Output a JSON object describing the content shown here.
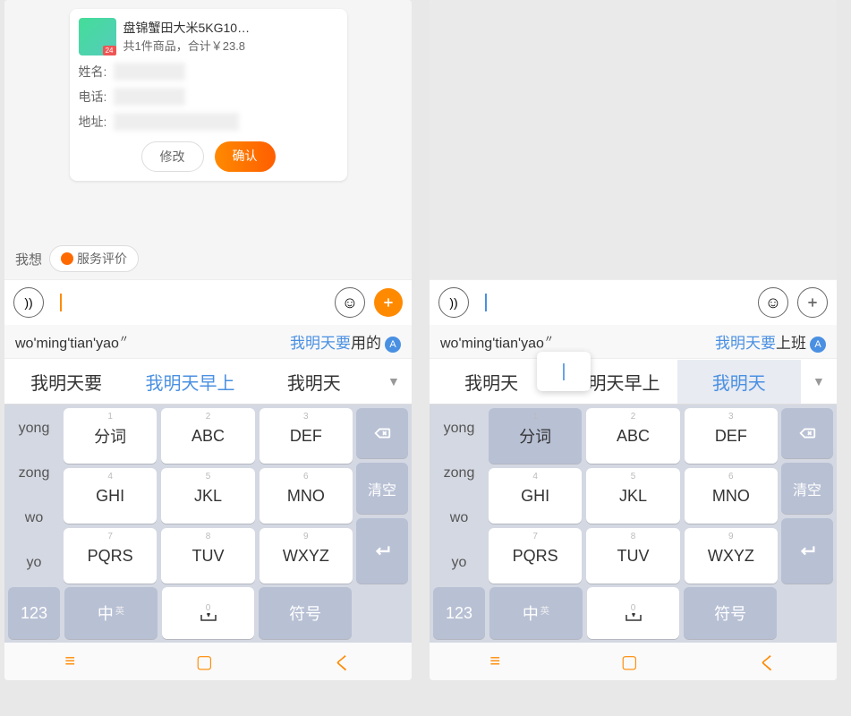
{
  "left": {
    "card": {
      "title": "盘锦蟹田大米5KG10…",
      "subtitle": "共1件商品，合计￥23.8",
      "fields": {
        "name": "姓名:",
        "phone": "电话:",
        "addr": "地址:"
      },
      "editBtn": "修改",
      "confirmBtn": "确认"
    },
    "quick": {
      "label": "我想",
      "chip": "服务评价"
    },
    "ime": {
      "pinyin": "wo'ming'tian'yao",
      "suggest_hl": "我明天要",
      "suggest_rest": "用的",
      "cands": [
        "我明天要",
        "我明天早上",
        "我明天"
      ]
    }
  },
  "right": {
    "ime": {
      "pinyin": "wo'ming'tian'yao",
      "suggest_hl": "我明天要",
      "suggest_rest": "上班",
      "cands": [
        "我明天",
        "我明天早上",
        "我明天"
      ]
    }
  },
  "kbd": {
    "sideCands": [
      "yong",
      "zong",
      "wo",
      "yo"
    ],
    "keys": [
      {
        "n": "1",
        "l": "分词"
      },
      {
        "n": "2",
        "l": "ABC"
      },
      {
        "n": "3",
        "l": "DEF"
      },
      {
        "n": "4",
        "l": "GHI"
      },
      {
        "n": "5",
        "l": "JKL"
      },
      {
        "n": "6",
        "l": "MNO"
      },
      {
        "n": "7",
        "l": "PQRS"
      },
      {
        "n": "8",
        "l": "TUV"
      },
      {
        "n": "9",
        "l": "WXYZ"
      }
    ],
    "clear": "清空",
    "bottom": {
      "num": "123",
      "lang": "中",
      "langSub": "英",
      "sym": "符号",
      "zero": "0"
    }
  }
}
